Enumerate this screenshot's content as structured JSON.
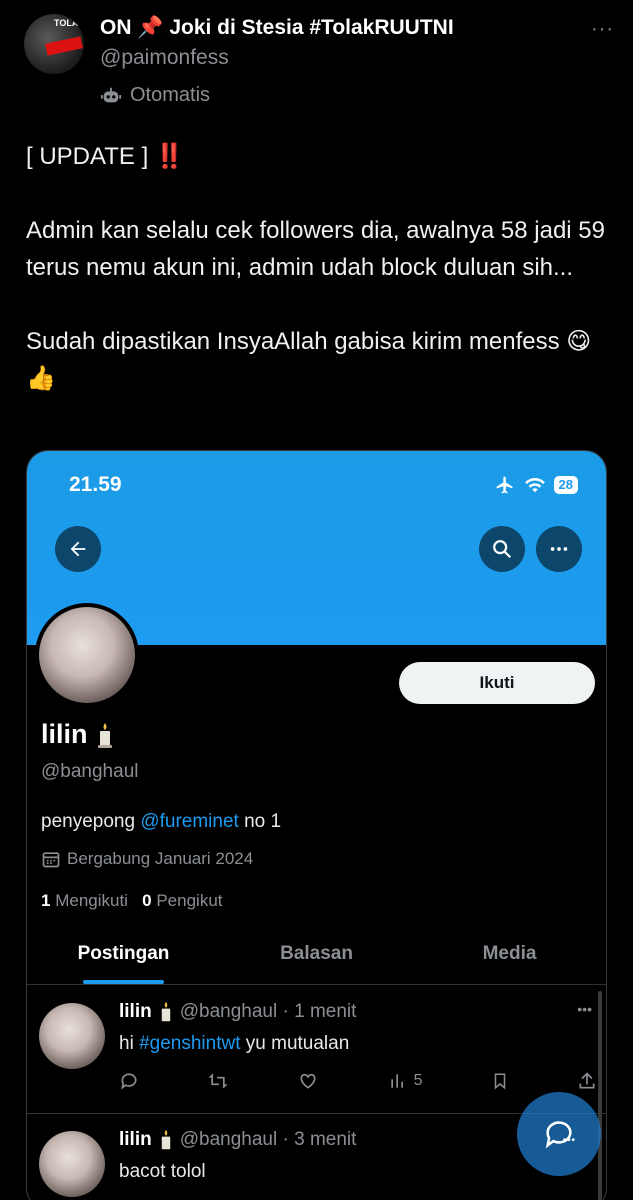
{
  "tweet": {
    "display_name": "ON 📌 Joki di Stesia #TolakRUUTNI",
    "handle": "@paimonfess",
    "automated_label": "Otomatis",
    "more_label": "···",
    "avatar_text": "TOLAK",
    "body": {
      "line1": "[ UPDATE ]",
      "line1_emoji": "‼️",
      "para2": "Admin kan selalu cek followers dia, awalnya 58 jadi 59 terus nemu akun ini, admin udah block duluan sih...",
      "para3": "Sudah dipastikan InsyaAllah gabisa kirim menfess 😋👍"
    }
  },
  "embedded": {
    "status_time": "21.59",
    "battery": "28",
    "follow_label": "Ikuti",
    "profile": {
      "name": "lilin",
      "handle": "@banghaul",
      "bio_prefix": "penyepong",
      "bio_mention": "@fureminet",
      "bio_suffix": "no 1",
      "joined": "Bergabung Januari 2024",
      "following_count": "1",
      "following_label": "Mengikuti",
      "followers_count": "0",
      "followers_label": "Pengikut"
    },
    "tabs": [
      "Postingan",
      "Balasan",
      "Media"
    ],
    "posts": [
      {
        "name": "lilin",
        "meta": "@banghaul · 1 menit",
        "text_prefix": "hi",
        "hashtag": "#genshintwt",
        "text_suffix": "yu mutualan",
        "views": "5"
      },
      {
        "name": "lilin",
        "meta": "@banghaul · 3 menit",
        "text_prefix": "bacot tolol",
        "hashtag": "",
        "text_suffix": ""
      }
    ]
  },
  "colors": {
    "background": "#000000",
    "banner": "#1d9bf0",
    "accent": "#1d9bf0",
    "muted": "#8b8f94",
    "alert": "#e0245e"
  },
  "icons": [
    "bot-icon",
    "back-arrow-icon",
    "search-icon",
    "more-icon",
    "airplane-icon",
    "wifi-icon",
    "calendar-icon",
    "reply-icon",
    "retweet-icon",
    "like-icon",
    "views-icon",
    "bookmark-icon",
    "share-icon",
    "compose-message-icon"
  ]
}
